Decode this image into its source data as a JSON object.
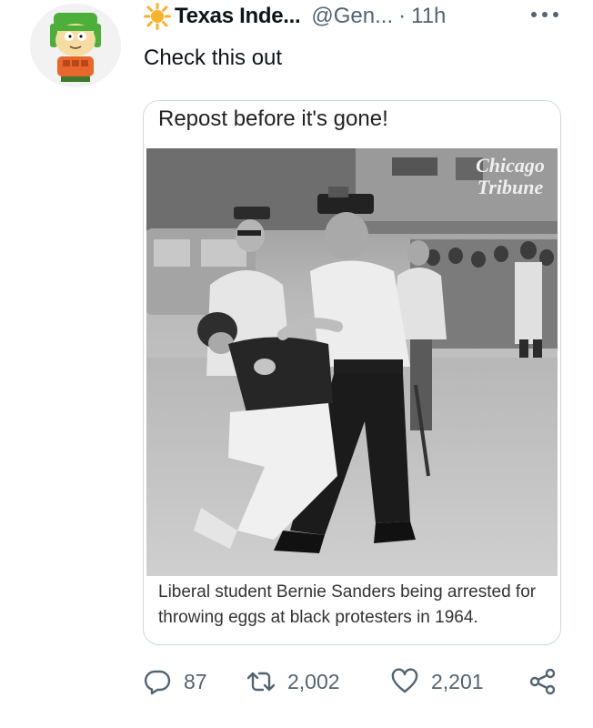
{
  "tweet": {
    "display_name": "Texas Inde...",
    "handle": "@Gen...",
    "separator": "·",
    "time": "11h",
    "text": "Check this out"
  },
  "media": {
    "header_text": "Repost before it's gone!",
    "watermark_line1": "Chicago",
    "watermark_line2": "Tribune",
    "caption": "Liberal student Bernie Sanders being arrested for throwing eggs at black protesters in 1964."
  },
  "actions": {
    "reply_count": "87",
    "retweet_count": "2,002",
    "like_count": "2,201"
  },
  "icons": {
    "verified_badge": "sun-emoji-icon",
    "more": "more-icon",
    "reply": "reply-icon",
    "retweet": "retweet-icon",
    "like": "heart-icon",
    "share": "share-icon"
  },
  "colors": {
    "text_primary": "#0f1419",
    "text_secondary": "#536471",
    "border": "#cfd9de",
    "sun": "#f7b32b"
  }
}
